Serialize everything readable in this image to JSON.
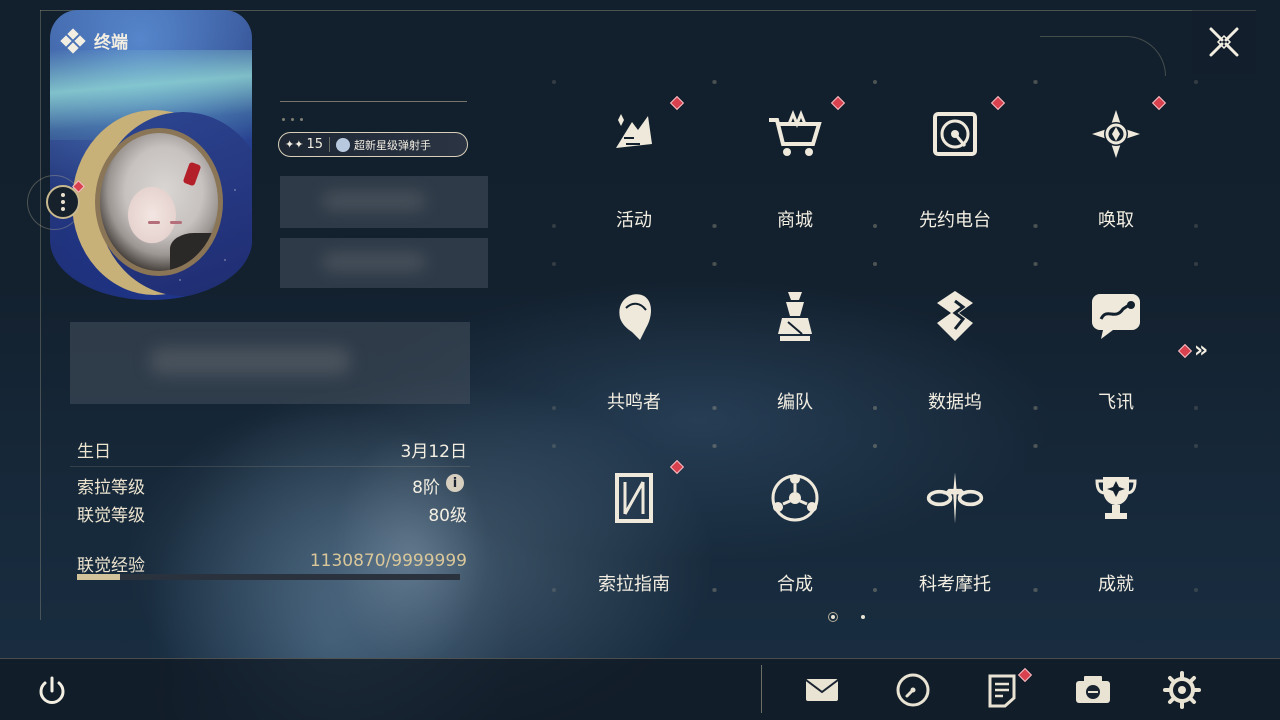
{
  "header": {
    "title": "终端",
    "close_icon": "close-icon"
  },
  "profile": {
    "rank_number": "15",
    "rank_title": "超新星级弹射手",
    "has_notification": true
  },
  "stats": {
    "birthday_label": "生日",
    "birthday_value": "3月12日",
    "sola_level_label": "索拉等级",
    "sola_level_value": "8阶",
    "union_level_label": "联觉等级",
    "union_level_value": "80级",
    "exp_label": "联觉经验",
    "exp_value": "1130870/9999999",
    "exp_fraction": 0.113
  },
  "menu": {
    "items": [
      {
        "label": "活动",
        "icon": "events-icon",
        "badge": true
      },
      {
        "label": "商城",
        "icon": "shop-cart-icon",
        "badge": true
      },
      {
        "label": "先约电台",
        "icon": "radio-icon",
        "badge": true
      },
      {
        "label": "唤取",
        "icon": "convene-icon",
        "badge": true
      },
      {
        "label": "共鸣者",
        "icon": "resonator-icon",
        "badge": false
      },
      {
        "label": "编队",
        "icon": "team-chess-icon",
        "badge": false
      },
      {
        "label": "数据坞",
        "icon": "data-bank-icon",
        "badge": false
      },
      {
        "label": "飞讯",
        "icon": "message-icon",
        "badge": false
      },
      {
        "label": "索拉指南",
        "icon": "guide-icon",
        "badge": true
      },
      {
        "label": "合成",
        "icon": "synthesis-icon",
        "badge": false
      },
      {
        "label": "科考摩托",
        "icon": "motorbike-icon",
        "badge": false
      },
      {
        "label": "成就",
        "icon": "trophy-icon",
        "badge": false
      }
    ],
    "page_count": 2,
    "current_page": 1
  },
  "bottom_bar": {
    "icons": [
      "power-icon",
      "mail-icon",
      "clock-icon",
      "notes-icon",
      "camera-icon",
      "settings-gear-icon"
    ],
    "notes_badge": true
  },
  "colors": {
    "accent_gold": "#d2c39b",
    "badge_red": "#d9414f",
    "text": "#f3eee2"
  }
}
